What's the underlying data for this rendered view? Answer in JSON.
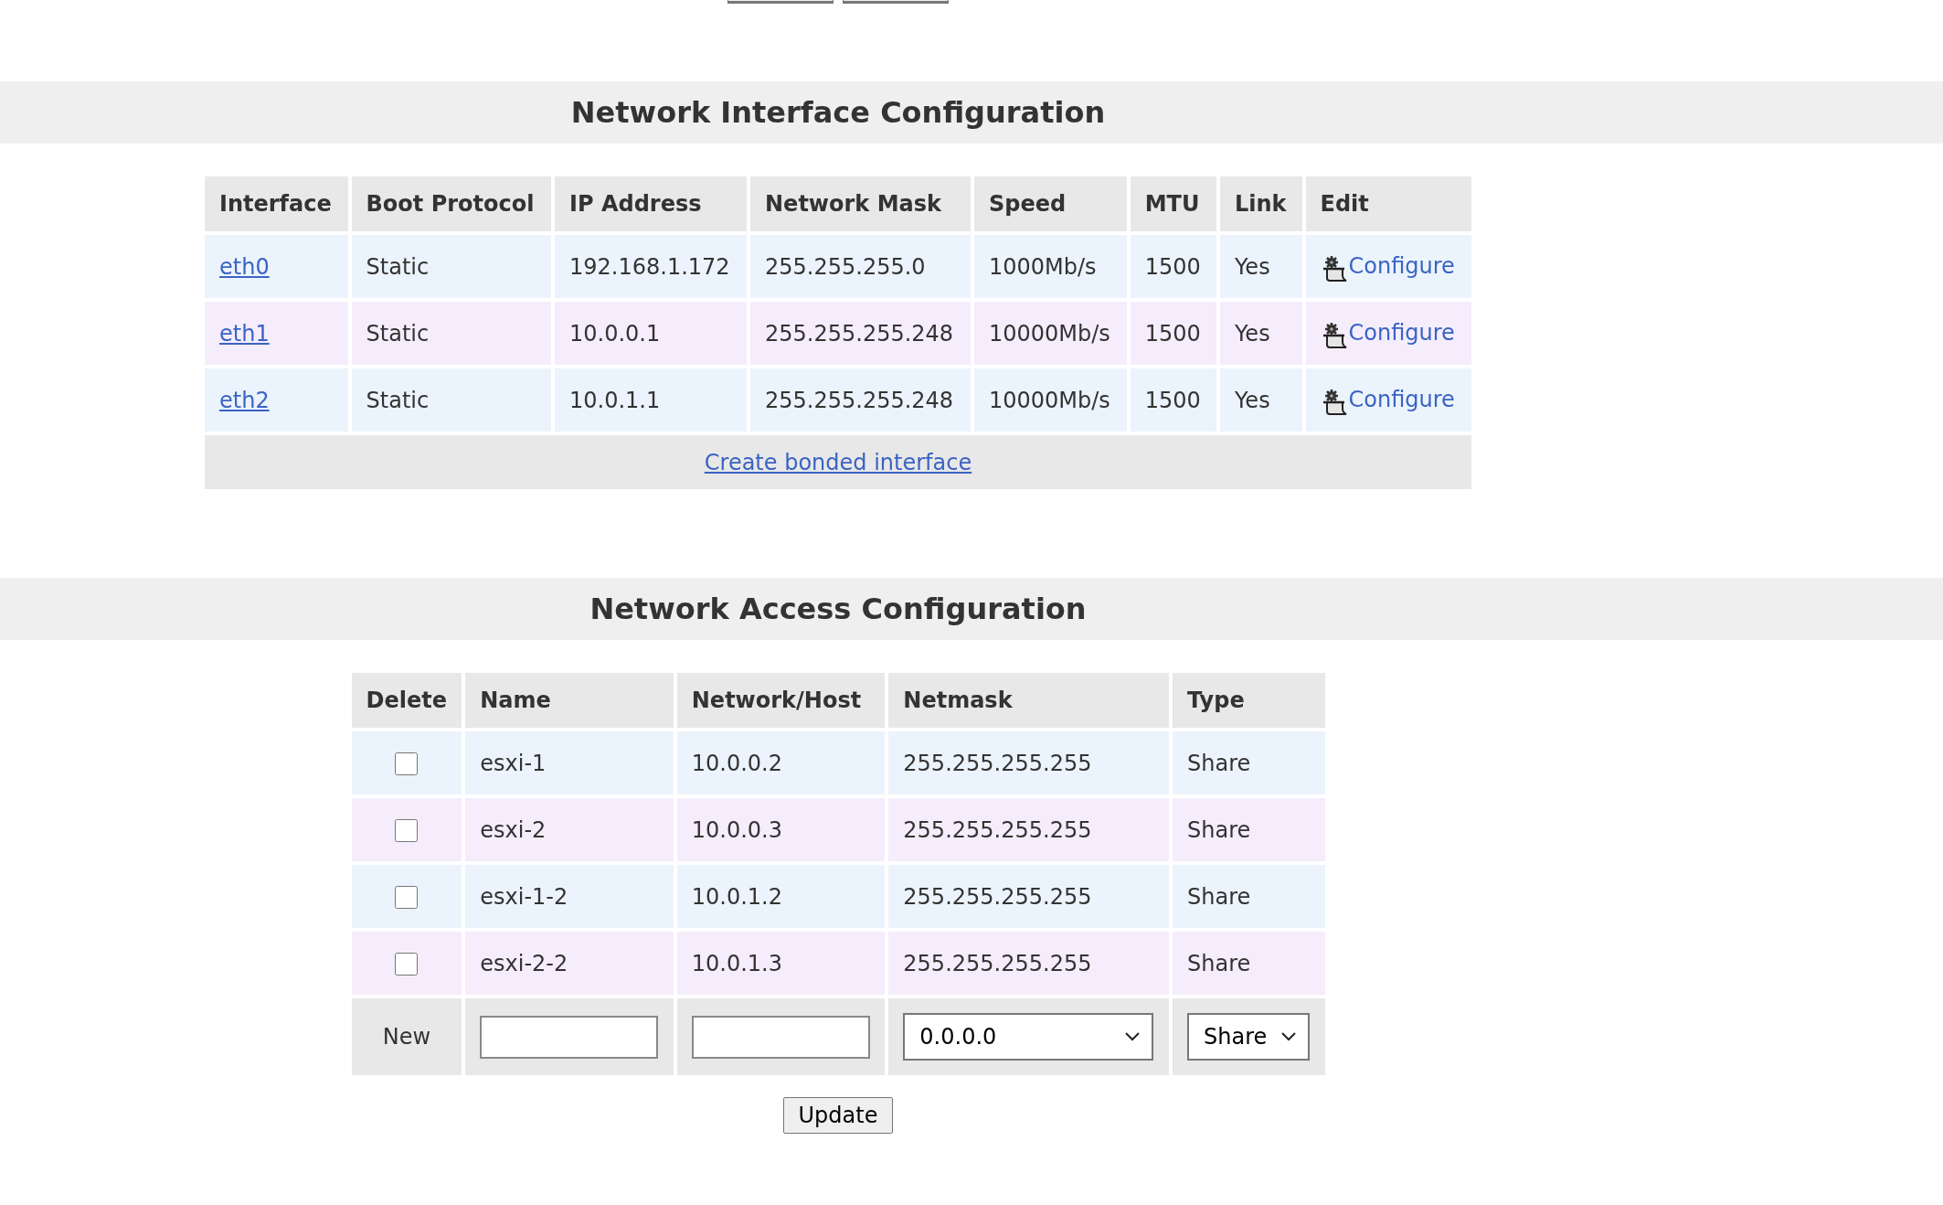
{
  "top_buttons": [
    {
      "kind": "cut"
    },
    {
      "kind": "cut"
    }
  ],
  "interface_section": {
    "title": "Network Interface Configuration",
    "columns": [
      "Interface",
      "Boot Protocol",
      "IP Address",
      "Network Mask",
      "Speed",
      "MTU",
      "Link",
      "Edit"
    ],
    "rows": [
      {
        "interface": "eth0",
        "boot_protocol": "Static",
        "ip_address": "192.168.1.172",
        "network_mask": "255.255.255.0",
        "speed": "1000Mb/s",
        "mtu": "1500",
        "link": "Yes",
        "edit": "Configure"
      },
      {
        "interface": "eth1",
        "boot_protocol": "Static",
        "ip_address": "10.0.0.1",
        "network_mask": "255.255.255.248",
        "speed": "10000Mb/s",
        "mtu": "1500",
        "link": "Yes",
        "edit": "Configure"
      },
      {
        "interface": "eth2",
        "boot_protocol": "Static",
        "ip_address": "10.0.1.1",
        "network_mask": "255.255.255.248",
        "speed": "10000Mb/s",
        "mtu": "1500",
        "link": "Yes",
        "edit": "Configure"
      }
    ],
    "footer_link": "Create bonded interface"
  },
  "access_section": {
    "title": "Network Access Configuration",
    "columns": [
      "Delete",
      "Name",
      "Network/Host",
      "Netmask",
      "Type"
    ],
    "rows": [
      {
        "checked": false,
        "name": "esxi-1",
        "network_host": "10.0.0.2",
        "netmask": "255.255.255.255",
        "type": "Share"
      },
      {
        "checked": false,
        "name": "esxi-2",
        "network_host": "10.0.0.3",
        "netmask": "255.255.255.255",
        "type": "Share"
      },
      {
        "checked": false,
        "name": "esxi-1-2",
        "network_host": "10.0.1.2",
        "netmask": "255.255.255.255",
        "type": "Share"
      },
      {
        "checked": false,
        "name": "esxi-2-2",
        "network_host": "10.0.1.3",
        "netmask": "255.255.255.255",
        "type": "Share"
      }
    ],
    "new_row": {
      "label": "New",
      "netmask_value": "0.0.0.0",
      "type_value": "Share"
    },
    "submit": "Update"
  }
}
